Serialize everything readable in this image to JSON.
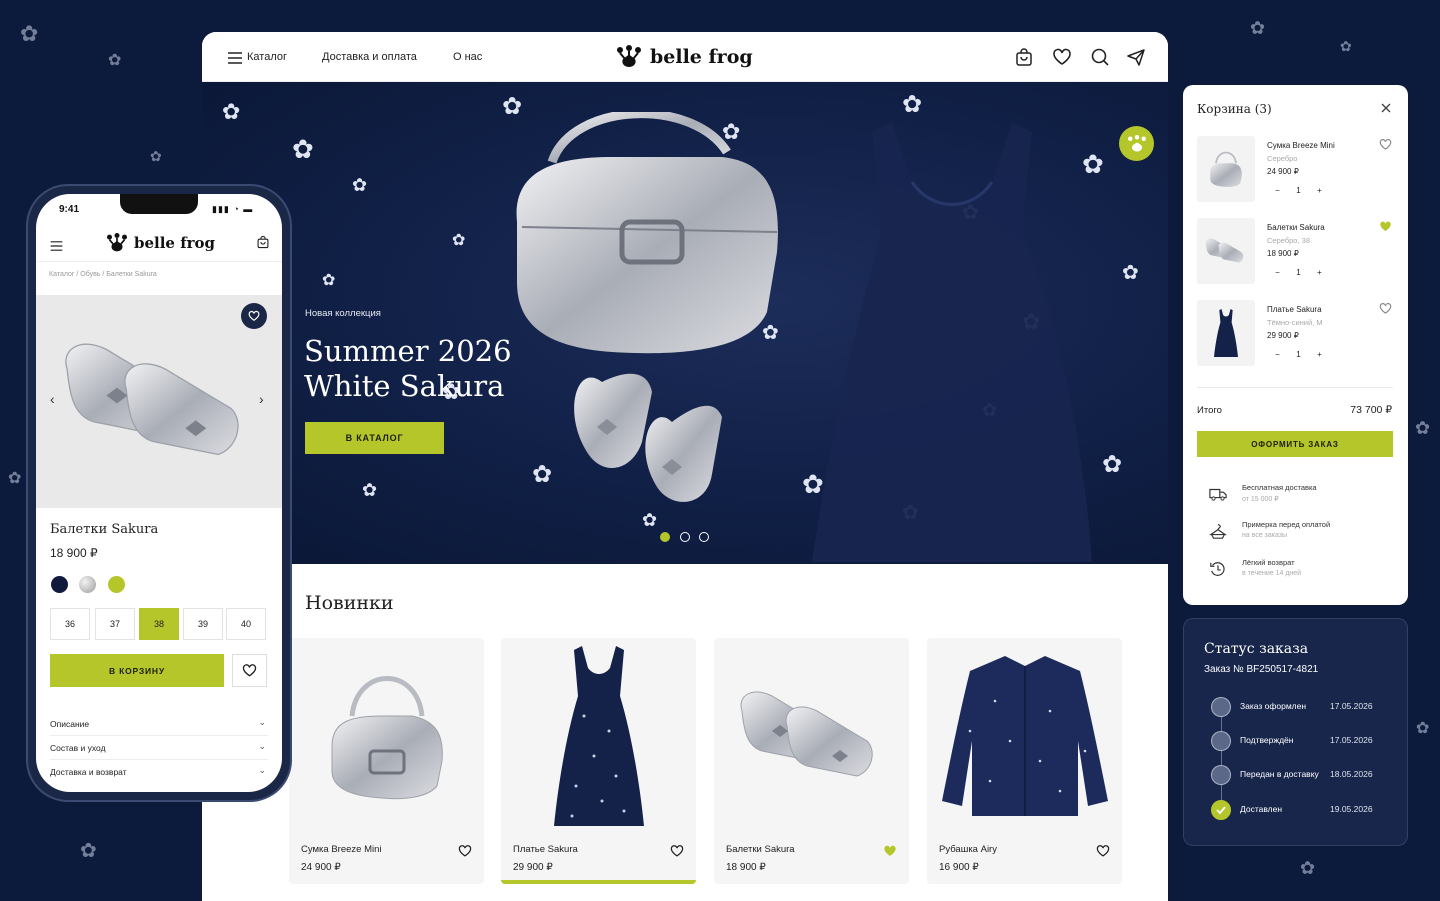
{
  "desktop": {
    "nav": {
      "catalog": "Каталог",
      "delivery": "Доставка и оплата",
      "about": "О нас",
      "brand": "belle frog",
      "icons": [
        "bag-icon",
        "heart-icon",
        "search-icon",
        "send-icon"
      ]
    },
    "hero": {
      "kicker": "Новая коллекция",
      "title_line1": "Summer 2026",
      "title_line2": "White Sakura",
      "cta": "В КАТАЛОГ",
      "slides": 3,
      "active_slide": 1
    },
    "new_section": {
      "title": "Новинки",
      "products": [
        {
          "name": "Сумка Breeze Mini",
          "price": "24 900 ₽",
          "favorite": false
        },
        {
          "name": "Платье Sakura",
          "price": "29 900 ₽",
          "favorite": false
        },
        {
          "name": "Балетки Sakura",
          "price": "18 900 ₽",
          "favorite": true
        },
        {
          "name": "Рубашка Airy",
          "price": "16 900 ₽",
          "favorite": false
        }
      ]
    }
  },
  "cart": {
    "title": "Корзина (3)",
    "items": [
      {
        "name": "Сумка Breeze Mini",
        "variant": "Серебро",
        "price": "24 900 ₽",
        "qty": "1",
        "favorite": false
      },
      {
        "name": "Балетки Sakura",
        "variant": "Серебро, 38",
        "price": "18 900 ₽",
        "qty": "1",
        "favorite": true
      },
      {
        "name": "Платье Sakura",
        "variant": "Тёмно-синий, M",
        "price": "29 900 ₽",
        "qty": "1",
        "favorite": false
      }
    ],
    "total_label": "Итого",
    "total_value": "73 700 ₽",
    "checkout": "ОФОРМИТЬ ЗАКАЗ",
    "features": [
      {
        "title": "Бесплатная доставка",
        "sub": "от 15 000 ₽",
        "icon": "truck-icon"
      },
      {
        "title": "Примерка перед оплатой",
        "sub": "на все заказы",
        "icon": "hanger-icon"
      },
      {
        "title": "Лёгкий возврат",
        "sub": "в течение 14 дней",
        "icon": "return-icon"
      }
    ]
  },
  "order_status": {
    "title": "Статус заказа",
    "number": "Заказ № BF250517-4821",
    "steps": [
      {
        "label": "Заказ оформлен",
        "date": "17.05.2026",
        "done": false
      },
      {
        "label": "Подтверждён",
        "date": "17.05.2026",
        "done": false
      },
      {
        "label": "Передан в доставку",
        "date": "18.05.2026",
        "done": false
      },
      {
        "label": "Доставлен",
        "date": "19.05.2026",
        "done": true
      }
    ]
  },
  "phone": {
    "time": "9:41",
    "brand": "belle frog",
    "breadcrumb": "Каталог  /  Обувь  /  Балетки Sakura",
    "product_name": "Балетки Sakura",
    "price": "18 900 ₽",
    "colors": [
      "#0f1a3d",
      "#bdbdbd",
      "#b5c62a"
    ],
    "sizes": [
      "36",
      "37",
      "38",
      "39",
      "40"
    ],
    "selected_size": "38",
    "add_to_cart": "В КОРЗИНУ",
    "accordion": [
      "Описание",
      "Состав и уход",
      "Доставка и возврат"
    ]
  },
  "colors": {
    "accent": "#b5c62a",
    "navy": "#0c1a3c"
  }
}
